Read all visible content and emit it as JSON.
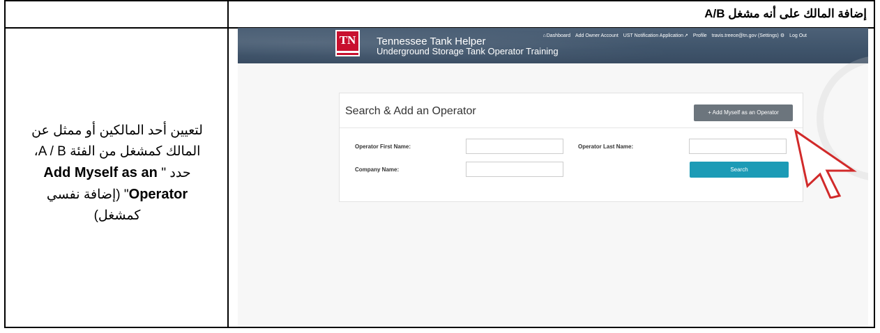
{
  "document": {
    "title": "إضافة المالك على أنه مشغل A/B",
    "instruction": {
      "line1": "لتعيين أحد المالكين أو ممثل عن",
      "line2": "المالك كمشغل من الفئة A / B،",
      "line3_prefix": "حدد \"",
      "line3_bold": " Add Myself as an",
      "line4_bold": "Operator",
      "line4_suffix": "\" (إضافة نفسي",
      "line5": "كمشغل)"
    }
  },
  "screenshot": {
    "logo": "TN",
    "site_title": "Tennessee Tank Helper",
    "site_subtitle": "Underground Storage Tank Operator Training",
    "nav": {
      "dashboard": "Dashboard",
      "add_owner": "Add Owner Account",
      "ust": "UST Notification Application",
      "profile": "Profile",
      "user": "travis.treece@tn.gov (Settings)",
      "logout": "Log Out"
    },
    "card": {
      "title": "Search & Add an Operator",
      "add_button": "+ Add Myself as an Operator",
      "first_name_label": "Operator First Name:",
      "last_name_label": "Operator Last Name:",
      "company_label": "Company Name:",
      "search_button": "Search"
    }
  }
}
